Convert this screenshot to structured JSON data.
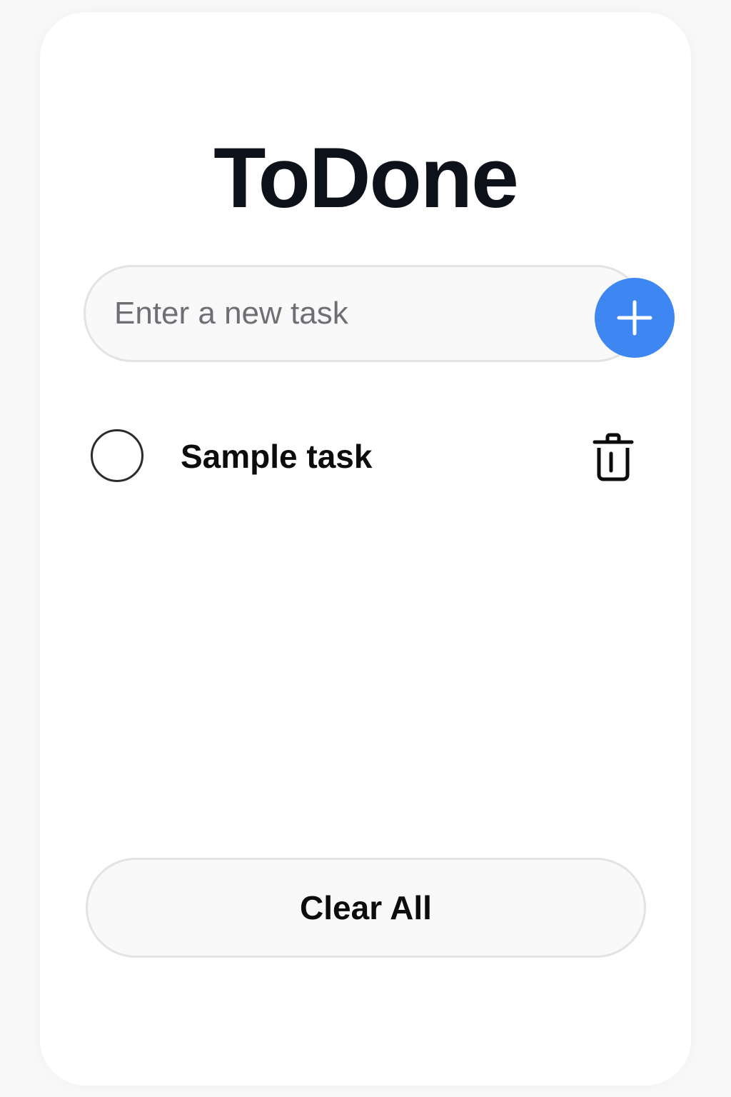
{
  "app": {
    "title": "ToDone"
  },
  "input": {
    "placeholder": "Enter a new task",
    "value": ""
  },
  "add_button": {
    "icon": "plus-icon",
    "color": "#3e87f3"
  },
  "tasks": [
    {
      "label": "Sample task",
      "completed": false,
      "delete_icon": "trash-icon"
    }
  ],
  "footer": {
    "clear_label": "Clear All"
  }
}
